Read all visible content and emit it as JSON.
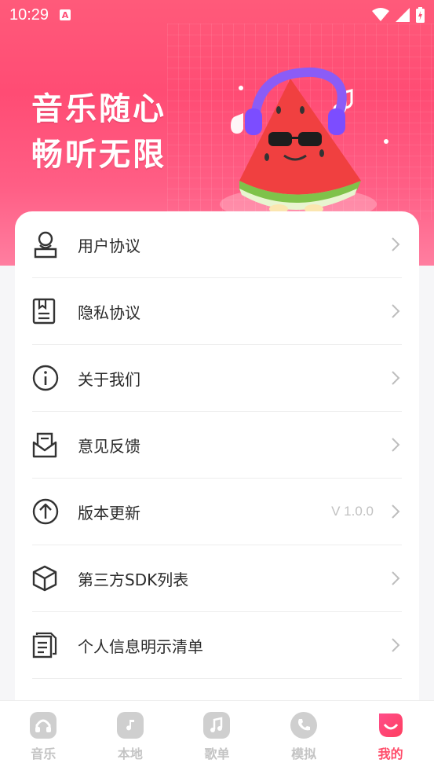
{
  "status_bar": {
    "time": "10:29",
    "app_icon_letter": "A"
  },
  "hero": {
    "line1": "音乐随心",
    "line2": "畅听无限"
  },
  "menu": [
    {
      "label": "用户协议",
      "icon": "user-badge-icon",
      "value": ""
    },
    {
      "label": "隐私协议",
      "icon": "privacy-doc-icon",
      "value": ""
    },
    {
      "label": "关于我们",
      "icon": "info-icon",
      "value": ""
    },
    {
      "label": "意见反馈",
      "icon": "feedback-mail-icon",
      "value": ""
    },
    {
      "label": "版本更新",
      "icon": "update-arrow-icon",
      "value": "V 1.0.0"
    },
    {
      "label": "第三方SDK列表",
      "icon": "cube-icon",
      "value": ""
    },
    {
      "label": "个人信息明示清单",
      "icon": "document-list-icon",
      "value": ""
    }
  ],
  "bottom_nav": [
    {
      "label": "音乐",
      "icon": "headphones-icon"
    },
    {
      "label": "本地",
      "icon": "folder-music-icon"
    },
    {
      "label": "歌单",
      "icon": "playlist-icon"
    },
    {
      "label": "模拟",
      "icon": "phone-icon"
    },
    {
      "label": "我的",
      "icon": "profile-icon",
      "active": true
    }
  ],
  "colors": {
    "accent": "#ff4d6a",
    "hero": "#ff4c74"
  }
}
